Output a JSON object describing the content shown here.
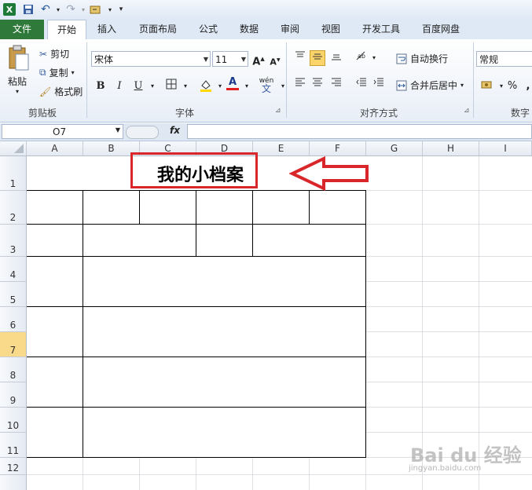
{
  "qat": {
    "undo_icon": "undo-icon",
    "redo_icon": "redo-icon"
  },
  "tabs": [
    {
      "label": "文件",
      "type": "file"
    },
    {
      "label": "开始",
      "type": "active"
    },
    {
      "label": "插入"
    },
    {
      "label": "页面布局"
    },
    {
      "label": "公式"
    },
    {
      "label": "数据"
    },
    {
      "label": "审阅"
    },
    {
      "label": "视图"
    },
    {
      "label": "开发工具"
    },
    {
      "label": "百度网盘"
    }
  ],
  "clipboard": {
    "paste": "粘贴",
    "cut": "剪切",
    "copy": "复制",
    "format_painter": "格式刷",
    "group": "剪贴板"
  },
  "font": {
    "name": "宋体",
    "size": "11",
    "group": "字体",
    "bold": "B",
    "italic": "I",
    "underline": "U",
    "phonetic": "wén"
  },
  "alignment": {
    "wrap": "自动换行",
    "merge": "合并后居中",
    "group": "对齐方式"
  },
  "number": {
    "format": "常规",
    "percent": "%",
    "group": "数字"
  },
  "formula_bar": {
    "name_box": "O7",
    "fx": "fx",
    "value": ""
  },
  "columns": [
    "A",
    "B",
    "C",
    "D",
    "E",
    "F",
    "G",
    "H",
    "I"
  ],
  "rows": [
    "1",
    "2",
    "3",
    "4",
    "5",
    "6",
    "7",
    "8",
    "9",
    "10",
    "11",
    "12"
  ],
  "selected_row": "7",
  "sheet": {
    "title": "我的小档案"
  },
  "watermark": {
    "brand": "Bai du 经验",
    "url": "jingyan.baidu.com"
  },
  "colors": {
    "file_tab": "#2f7a3a",
    "highlight_box": "#d9262a",
    "font_red": "#e02020",
    "fill_yellow": "#ffd800"
  }
}
